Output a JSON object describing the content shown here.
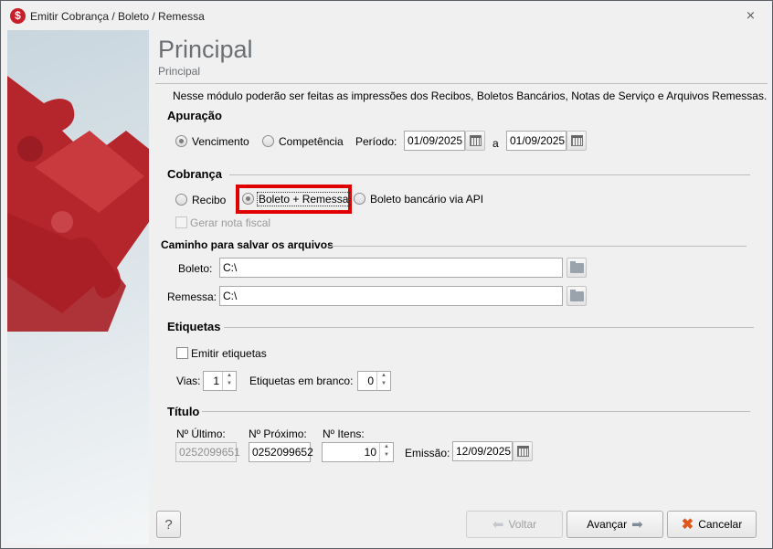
{
  "window": {
    "title": "Emitir Cobrança / Boleto / Remessa",
    "icon": "dollar-icon",
    "close": "⨯"
  },
  "header": {
    "title": "Principal",
    "subtitle": "Principal"
  },
  "description": "Nesse módulo poderão ser feitas as impressões dos Recibos, Boletos Bancários, Notas de Serviço e Arquivos Remessas.",
  "apuracao": {
    "label": "Apuração",
    "vencimento": "Vencimento",
    "competencia": "Competência",
    "selected": "Vencimento",
    "periodo_label": "Período:",
    "de": "01/09/2025",
    "a_label": "a",
    "ate": "01/09/2025"
  },
  "cobranca": {
    "label": "Cobrança",
    "recibo": "Recibo",
    "boleto_remessa": "Boleto + Remessa",
    "boleto_api": "Boleto bancário via API",
    "selected": "Boleto + Remessa",
    "gerar_nf": "Gerar nota fiscal",
    "highlight_color": "#e00000"
  },
  "caminho": {
    "label": "Caminho para salvar os arquivos",
    "boleto_label": "Boleto:",
    "boleto_value": "C:\\",
    "remessa_label": "Remessa:",
    "remessa_value": "C:\\"
  },
  "etiquetas": {
    "label": "Etiquetas",
    "emitir": "Emitir etiquetas",
    "vias_label": "Vias:",
    "vias": "1",
    "branco_label": "Etiquetas em branco:",
    "branco": "0"
  },
  "titulo": {
    "label": "Título",
    "ultimo_label": "Nº Último:",
    "ultimo": "0252099651",
    "proximo_label": "Nº Próximo:",
    "proximo": "0252099652",
    "itens_label": "Nº Itens:",
    "itens": "10",
    "emissao_label": "Emissão:",
    "emissao": "12/09/2025"
  },
  "footer": {
    "help": "?",
    "voltar": "Voltar",
    "avancar": "Avançar",
    "cancelar": "Cancelar"
  }
}
